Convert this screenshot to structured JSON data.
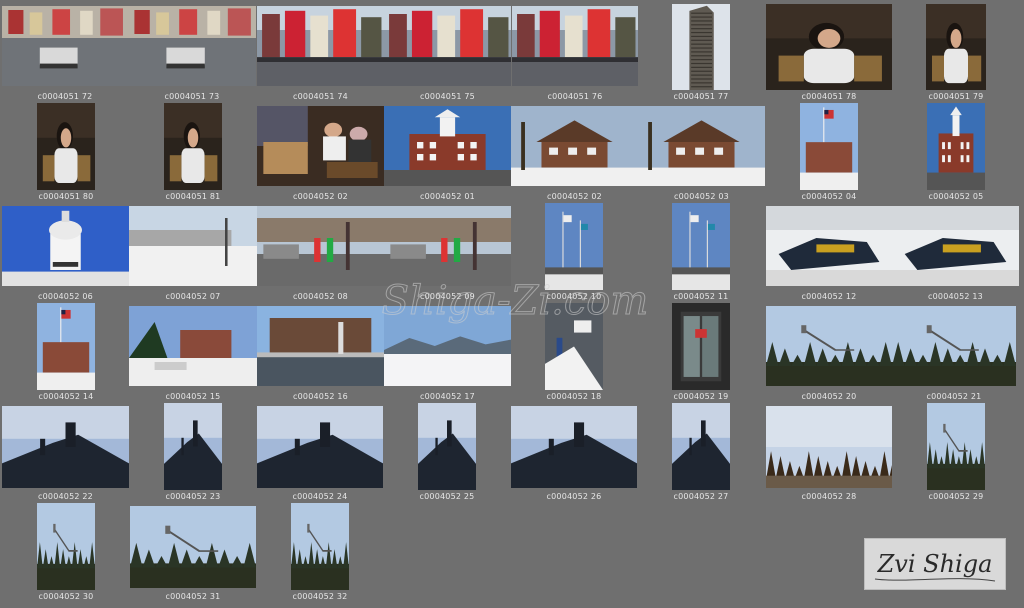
{
  "watermark": "Shiga-Zi.com",
  "signature": "Zvi Shiga",
  "photos": [
    {
      "id": "c0004051 72",
      "scene": "city-street"
    },
    {
      "id": "c0004051 73",
      "scene": "city-street"
    },
    {
      "id": "c0004051 74",
      "scene": "times-square"
    },
    {
      "id": "c0004051 75",
      "scene": "times-square"
    },
    {
      "id": "c0004051 76",
      "scene": "times-square"
    },
    {
      "id": "c0004051 77",
      "scene": "skyscraper"
    },
    {
      "id": "c0004051 78",
      "scene": "interior-person"
    },
    {
      "id": "c0004051 79",
      "scene": "interior-person"
    },
    {
      "id": "c0004051 80",
      "scene": "interior-person"
    },
    {
      "id": "c0004051 81",
      "scene": "interior-person"
    },
    {
      "id": "c0004052 02",
      "scene": "interior-group"
    },
    {
      "id": "c0004052 01",
      "scene": "town-hall"
    },
    {
      "id": "c0004052 02",
      "scene": "house-snow"
    },
    {
      "id": "c0004052 03",
      "scene": "house-snow"
    },
    {
      "id": "c0004052 04",
      "scene": "flag-building"
    },
    {
      "id": "c0004052 05",
      "scene": "town-hall"
    },
    {
      "id": "c0004052 06",
      "scene": "clock-tower"
    },
    {
      "id": "c0004052 07",
      "scene": "winter-street"
    },
    {
      "id": "c0004052 08",
      "scene": "street-people"
    },
    {
      "id": "c0004052 09",
      "scene": "street-people"
    },
    {
      "id": "c0004052 10",
      "scene": "flagpoles"
    },
    {
      "id": "c0004052 11",
      "scene": "flagpoles"
    },
    {
      "id": "c0004052 12",
      "scene": "snowmobiles"
    },
    {
      "id": "c0004052 13",
      "scene": "snowmobiles"
    },
    {
      "id": "c0004052 14",
      "scene": "flag-building"
    },
    {
      "id": "c0004052 15",
      "scene": "town-cars"
    },
    {
      "id": "c0004052 16",
      "scene": "lake-hotel"
    },
    {
      "id": "c0004052 17",
      "scene": "frozen-lake"
    },
    {
      "id": "c0004052 18",
      "scene": "snow-sign"
    },
    {
      "id": "c0004052 19",
      "scene": "doorway"
    },
    {
      "id": "c0004052 20",
      "scene": "ski-jump-forest"
    },
    {
      "id": "c0004052 21",
      "scene": "ski-jump-forest"
    },
    {
      "id": "c0004052 22",
      "scene": "ski-jump-silhouette"
    },
    {
      "id": "c0004052 23",
      "scene": "ski-jump-silhouette"
    },
    {
      "id": "c0004052 24",
      "scene": "ski-jump-silhouette"
    },
    {
      "id": "c0004052 25",
      "scene": "ski-jump-silhouette"
    },
    {
      "id": "c0004052 26",
      "scene": "ski-jump-silhouette"
    },
    {
      "id": "c0004052 27",
      "scene": "ski-jump-silhouette"
    },
    {
      "id": "c0004052 28",
      "scene": "forest-horizon"
    },
    {
      "id": "c0004052 29",
      "scene": "ski-jump-forest"
    },
    {
      "id": "c0004052 30",
      "scene": "ski-jump-forest"
    },
    {
      "id": "c0004052 31",
      "scene": "ski-jump-forest"
    },
    {
      "id": "c0004052 32",
      "scene": "ski-jump-forest"
    }
  ],
  "colors": {
    "background": "#6f6f6f",
    "caption": "#e6e6e6",
    "watermark": "#c9c9c9"
  }
}
